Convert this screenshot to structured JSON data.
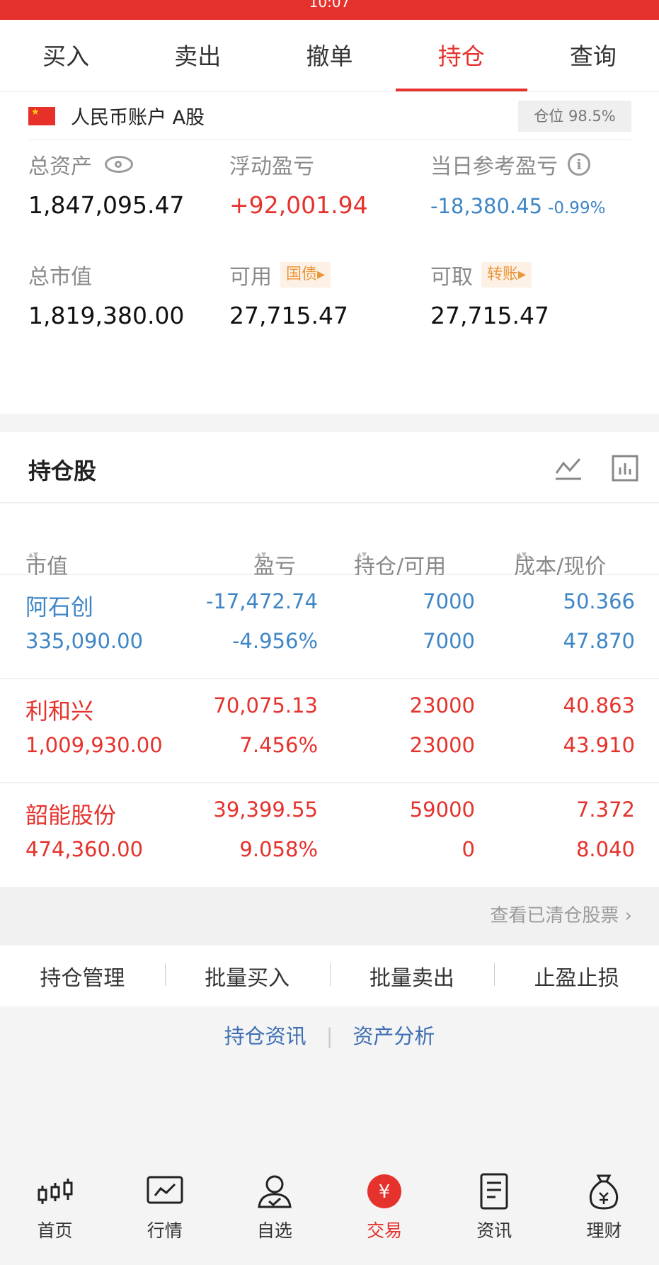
{
  "top_bar": {
    "text": "10:07"
  },
  "tabs": [
    {
      "label": "买入"
    },
    {
      "label": "卖出"
    },
    {
      "label": "撤单"
    },
    {
      "label": "持仓",
      "active": true
    },
    {
      "label": "查询"
    }
  ],
  "account": {
    "name": "人民币账户 A股",
    "position_badge": "仓位 98.5%"
  },
  "metrics": {
    "total_assets": {
      "label": "总资产",
      "value": "1,847,095.47"
    },
    "floating_pnl": {
      "label": "浮动盈亏",
      "value": "+92,001.94"
    },
    "daily_pnl": {
      "label": "当日参考盈亏",
      "value": "-18,380.45",
      "pct": "-0.99%"
    },
    "market_value": {
      "label": "总市值",
      "value": "1,819,380.00"
    },
    "available": {
      "label": "可用",
      "tag": "国债▸",
      "value": "27,715.47"
    },
    "withdrawable": {
      "label": "可取",
      "tag": "转账▸",
      "value": "27,715.47"
    }
  },
  "holdings_section": {
    "title": "持仓股"
  },
  "columns": {
    "market_value": "市值",
    "pnl": "盈亏",
    "position": "持仓/可用",
    "cost_price": "成本/现价",
    "sort_glyph": "▴▾",
    "more_glyph": "▸"
  },
  "holdings": [
    {
      "name": "阿石创",
      "market_value": "335,090.00",
      "pnl": "-17,472.74",
      "pnl_pct": "-4.956%",
      "position": "7000",
      "available": "7000",
      "cost": "50.366",
      "price": "47.870",
      "color": "#3f86c6"
    },
    {
      "name": "利和兴",
      "market_value": "1,009,930.00",
      "pnl": "70,075.13",
      "pnl_pct": "7.456%",
      "position": "23000",
      "available": "23000",
      "cost": "40.863",
      "price": "43.910",
      "color": "#e5322d"
    },
    {
      "name": "韶能股份",
      "market_value": "474,360.00",
      "pnl": "39,399.55",
      "pnl_pct": "9.058%",
      "position": "59000",
      "available": "0",
      "cost": "7.372",
      "price": "8.040",
      "color": "#e5322d"
    }
  ],
  "cleared_link": "查看已清仓股票 ›",
  "actions": [
    "持仓管理",
    "批量买入",
    "批量卖出",
    "止盈止损"
  ],
  "links": [
    "持仓资讯",
    "资产分析"
  ],
  "bottom_nav": [
    {
      "label": "首页",
      "icon": "candlestick-icon"
    },
    {
      "label": "行情",
      "icon": "chart-screen-icon"
    },
    {
      "label": "自选",
      "icon": "user-check-icon"
    },
    {
      "label": "交易",
      "icon": "yuan-icon",
      "active": true
    },
    {
      "label": "资讯",
      "icon": "document-icon"
    },
    {
      "label": "理财",
      "icon": "money-bag-icon"
    }
  ],
  "colors": {
    "accent": "#e5322d",
    "up": "#e5322d",
    "down": "#3f86c6",
    "tag": "#e9963a"
  }
}
